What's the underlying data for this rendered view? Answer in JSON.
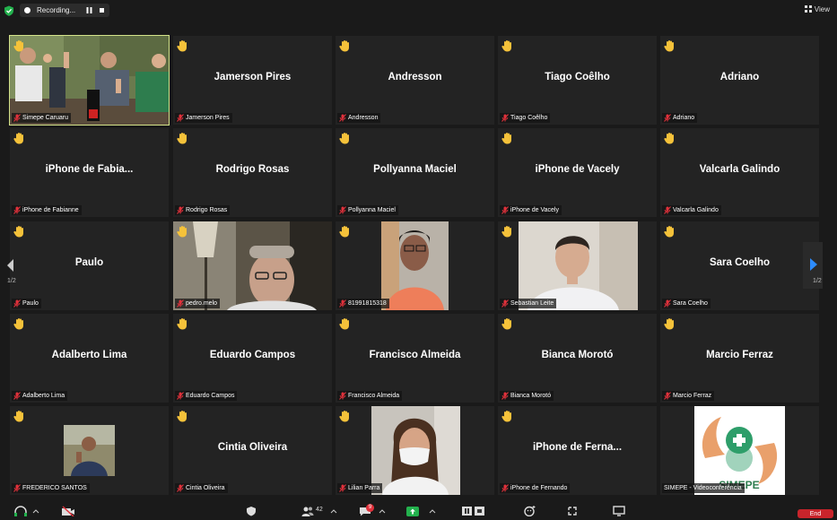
{
  "topbar": {
    "recording_label": "Recording...",
    "view_label": "View"
  },
  "colors": {
    "background": "#1a1a1a",
    "tile": "#232323",
    "active_speaker_border": "#d4e38a",
    "hand": "#f5c23a",
    "mic_muted": "#e0313b",
    "pager_arrow": "#2d8cff",
    "end_button": "#c8242b"
  },
  "tiles": [
    {
      "name": "",
      "label": "Simepe Caruaru",
      "hand": true,
      "video": "group"
    },
    {
      "name": "Jamerson Pires",
      "label": "Jamerson Pires",
      "hand": true
    },
    {
      "name": "Andresson",
      "label": "Andresson",
      "hand": true
    },
    {
      "name": "Tiago Coêlho",
      "label": "Tiago Coêlho",
      "hand": true
    },
    {
      "name": "Adriano",
      "label": "Adriano",
      "hand": true
    },
    {
      "name": "iPhone de Fabia...",
      "label": "iPhone de Fabianne",
      "hand": true
    },
    {
      "name": "Rodrigo Rosas",
      "label": "Rodrigo Rosas",
      "hand": true
    },
    {
      "name": "Pollyanna Maciel",
      "label": "Pollyanna Maciel",
      "hand": true
    },
    {
      "name": "iPhone de Vacely",
      "label": "iPhone de Vacely",
      "hand": true
    },
    {
      "name": "Valcarla Galindo",
      "label": "Valcarla Galindo",
      "hand": true
    },
    {
      "name": "Paulo",
      "label": "Paulo",
      "hand": true
    },
    {
      "name": "",
      "label": "pedro.melo",
      "hand": true,
      "video": "man-glasses"
    },
    {
      "name": "",
      "label": "81991815318",
      "hand": true,
      "video": "woman-orange"
    },
    {
      "name": "",
      "label": "Sebastian Leite",
      "hand": true,
      "video": "man-white"
    },
    {
      "name": "Sara Coelho",
      "label": "Sara Coelho",
      "hand": true
    },
    {
      "name": "Adalberto Lima",
      "label": "Adalberto Lima",
      "hand": true
    },
    {
      "name": "Eduardo Campos",
      "label": "Eduardo Campos",
      "hand": true
    },
    {
      "name": "Francisco Almeida",
      "label": "Francisco Almeida",
      "hand": true
    },
    {
      "name": "Bianca Morotó",
      "label": "Bianca Morotó",
      "hand": true
    },
    {
      "name": "Marcio Ferraz",
      "label": "Marcio Ferraz",
      "hand": true
    },
    {
      "name": "",
      "label": "FREDERICO SANTOS",
      "hand": true,
      "video": "small-photo"
    },
    {
      "name": "Cintia Oliveira",
      "label": "Cintia Oliveira",
      "hand": true
    },
    {
      "name": "",
      "label": "Lilian Parra",
      "hand": true,
      "video": "woman-mask"
    },
    {
      "name": "iPhone de Ferna...",
      "label": "iPhone de Fernando",
      "hand": true
    },
    {
      "name": "",
      "label": "SIMEPE - Videoconferência",
      "hand": false,
      "video": "logo"
    }
  ],
  "pager": {
    "left_page": "1/2",
    "right_page": "1/2"
  },
  "logo_text": "SIMEPE",
  "bottombar": {
    "participants_count": "42",
    "chat_badge": "9",
    "end_label": "End"
  }
}
